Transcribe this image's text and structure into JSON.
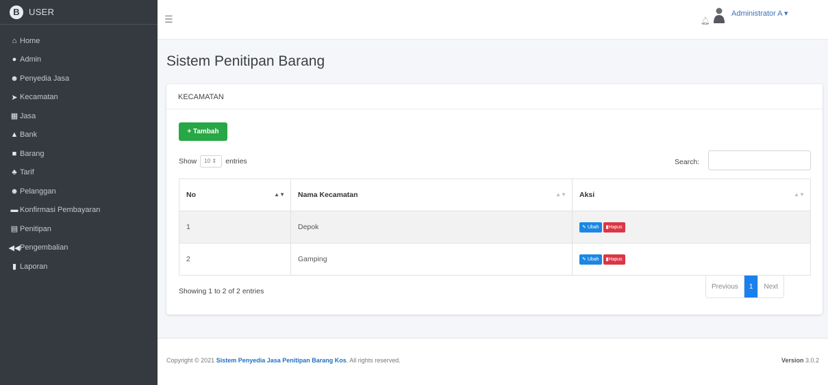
{
  "brand": {
    "name": "USER"
  },
  "sidebar": {
    "items": [
      {
        "label": "Home",
        "icon": "home-icon"
      },
      {
        "label": "Admin",
        "icon": "user-icon"
      },
      {
        "label": "Penyedia Jasa",
        "icon": "users-icon"
      },
      {
        "label": "Kecamatan",
        "icon": "location-arrow-icon"
      },
      {
        "label": "Jasa",
        "icon": "table-icon"
      },
      {
        "label": "Bank",
        "icon": "bank-icon"
      },
      {
        "label": "Barang",
        "icon": "box-icon"
      },
      {
        "label": "Tarif",
        "icon": "tree-icon"
      },
      {
        "label": "Pelanggan",
        "icon": "users-icon"
      },
      {
        "label": "Konfirmasi Pembayaran",
        "icon": "money-icon"
      },
      {
        "label": "Penitipan",
        "icon": "list-icon"
      },
      {
        "label": "Pengembalian",
        "icon": "backward-icon"
      },
      {
        "label": "Laporan",
        "icon": "file-icon"
      }
    ]
  },
  "topbar": {
    "user_name": "Administrator A"
  },
  "page": {
    "title": "Sistem Penitipan Barang"
  },
  "card": {
    "header": "KECAMATAN",
    "add_label": "+ Tambah",
    "show_label": "Show",
    "entries_value": "10",
    "entries_label": "entries",
    "search_label": "Search:",
    "columns": [
      "No",
      "Nama Kecamatan",
      "Aksi"
    ],
    "rows": [
      {
        "no": "1",
        "name": "Depok",
        "edit": "Ubah",
        "delete": "Hapus"
      },
      {
        "no": "2",
        "name": "Gamping",
        "edit": "Ubah",
        "delete": "Hapus"
      }
    ],
    "info": "Showing 1 to 2 of 2 entries",
    "pagination": {
      "previous": "Previous",
      "current": "1",
      "next": "Next"
    }
  },
  "footer": {
    "copyright_prefix": "Copyright © 2021",
    "site_name": "Sistem Penyedia Jasa Penitipan Barang Kos",
    "rights": ". All rights reserved.",
    "version_label": "Version",
    "version": "3.0.2"
  },
  "colors": {
    "sidebar": "#343a40",
    "accent": "#007bff",
    "success": "#28a745",
    "danger": "#dc3545"
  }
}
